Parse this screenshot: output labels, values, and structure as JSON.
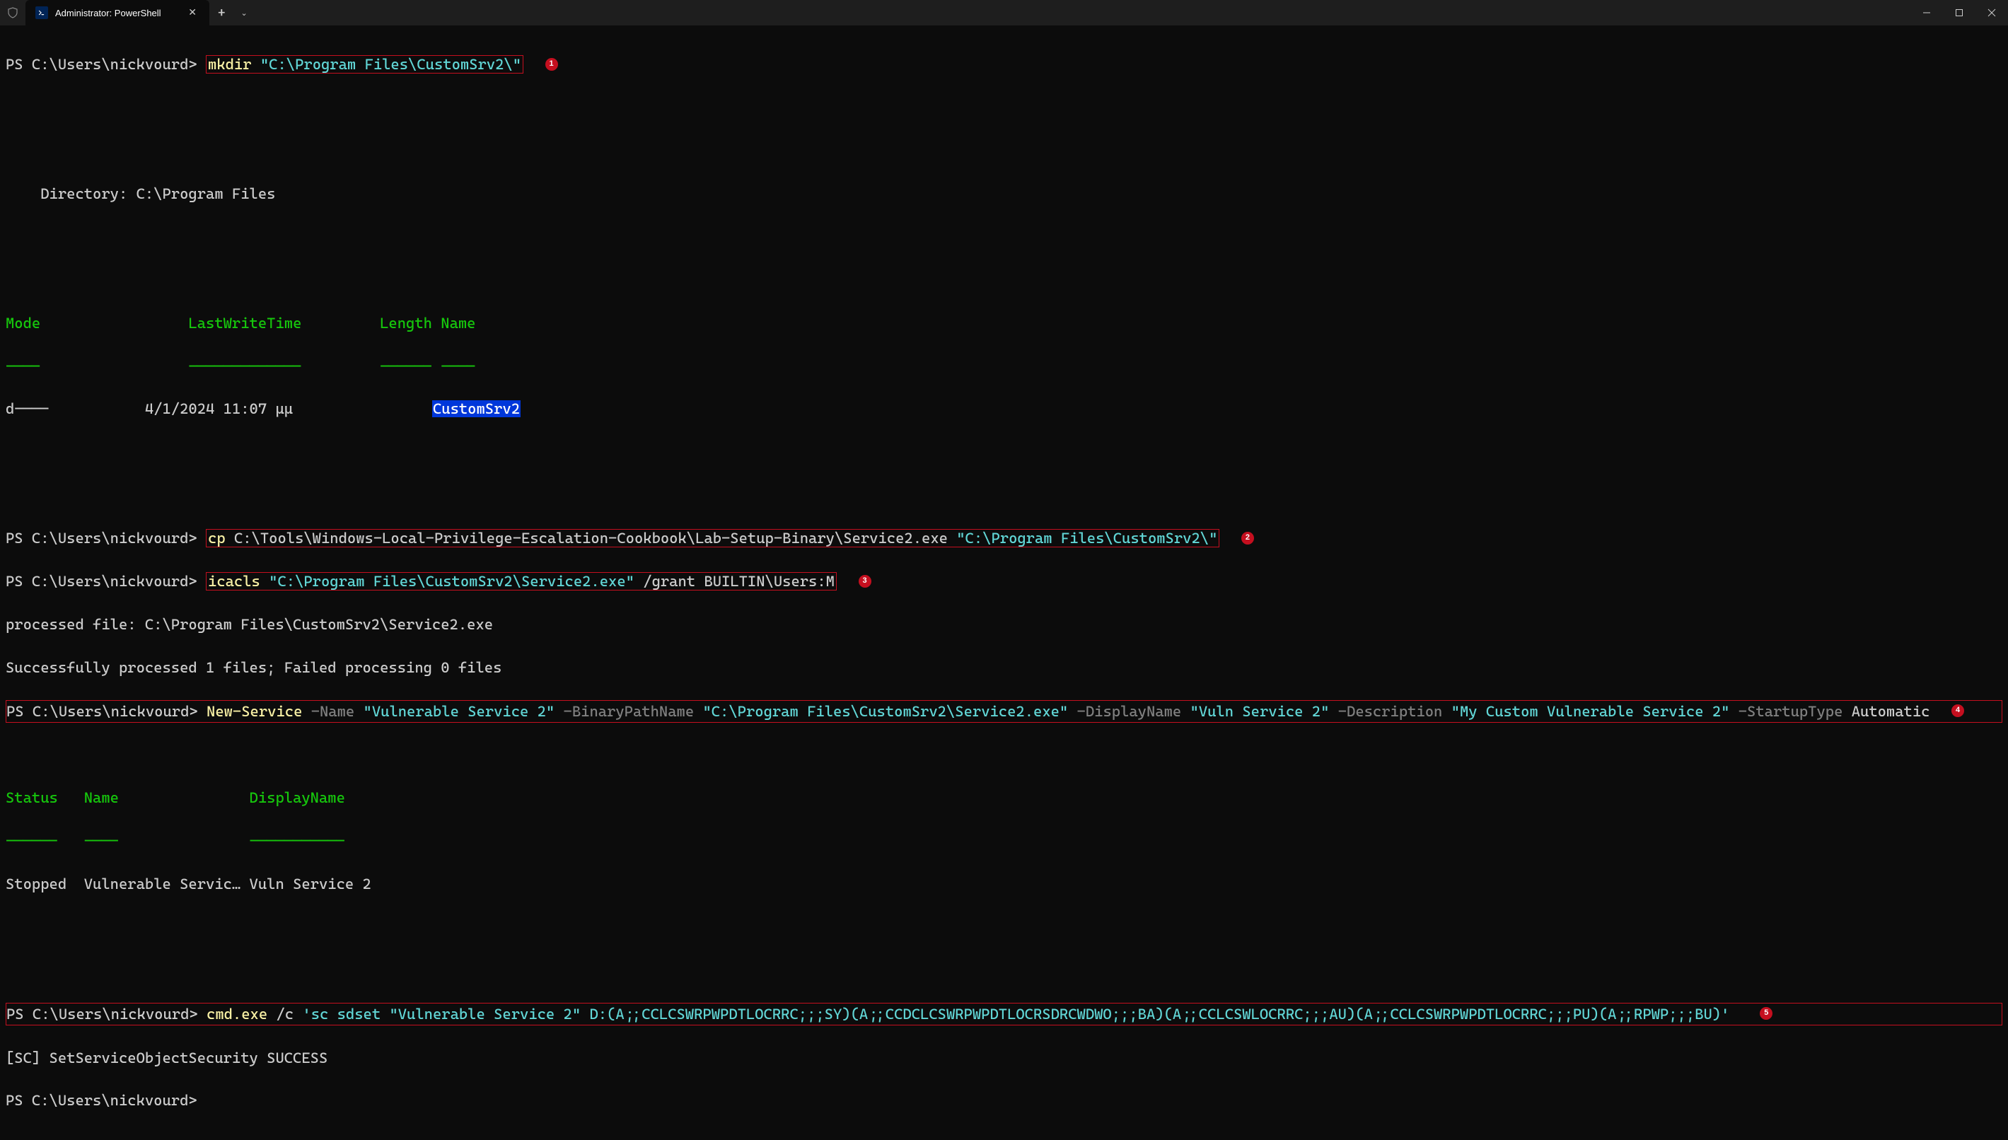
{
  "titlebar": {
    "tab_title": "Administrator: PowerShell",
    "new_tab": "+",
    "dropdown": "⌄",
    "minimize": "—",
    "maximize": "❐",
    "close": "✕"
  },
  "prompts": {
    "p1": "PS C:\\Users\\nickvourd> ",
    "dir_label": "    Directory: C:\\Program Files",
    "header_mode": "Mode",
    "header_lwt": "LastWriteTime",
    "header_length": "Length",
    "header_name": "Name",
    "dashes_mode": "----",
    "dashes_lwt": "-------------",
    "dashes_length": "------",
    "dashes_name": "----",
    "row_mode": "d----",
    "row_date": "4/1/2024 11:07 μμ",
    "row_name": "CustomSrv2",
    "processed": "processed file: C:\\Program Files\\CustomSrv2\\Service2.exe",
    "success": "Successfully processed 1 files; Failed processing 0 files",
    "status_hdr": "Status",
    "name_hdr": "Name",
    "display_hdr": "DisplayName",
    "status_dash": "------",
    "name_dash": "----",
    "display_dash": "-----------",
    "row_status": "Stopped",
    "row_name2": "Vulnerable Servic…",
    "row_disp": "Vuln Service 2",
    "sc_result": "[SC] SetServiceObjectSecurity SUCCESS"
  },
  "commands": {
    "cmd1_kw": "mkdir",
    "cmd1_arg": "\"C:\\Program Files\\CustomSrv2\\\"",
    "cmd2_kw": "cp",
    "cmd2_src": "C:\\Tools\\Windows-Local-Privilege-Escalation-Cookbook\\Lab-Setup-Binary\\Service2.exe",
    "cmd2_dst": "\"C:\\Program Files\\CustomSrv2\\\"",
    "cmd3_kw": "icacls",
    "cmd3_path": "\"C:\\Program Files\\CustomSrv2\\Service2.exe\"",
    "cmd3_grant": "/grant BUILTIN\\Users:M",
    "cmd4_kw": "New-Service",
    "cmd4_p_name": "-Name",
    "cmd4_v_name": "\"Vulnerable Service 2\"",
    "cmd4_p_bin": "-BinaryPathName",
    "cmd4_v_bin": "\"C:\\Program Files\\CustomSrv2\\Service2.exe\"",
    "cmd4_p_disp": "-DisplayName",
    "cmd4_v_disp": "\"Vuln Service 2\"",
    "cmd4_p_desc": "-Description",
    "cmd4_v_desc": "\"My Custom Vulnerable Service 2\"",
    "cmd4_p_start": "-StartupType",
    "cmd4_v_start": "Automatic",
    "cmd5_kw": "cmd.exe",
    "cmd5_c": "/c",
    "cmd5_arg": "'sc sdset \"Vulnerable Service 2\" D:(A;;CCLCSWRPWPDTLOCRRC;;;SY)(A;;CCDCLCSWRPWPDTLOCRSDRCWDWO;;;BA)(A;;CCLCSWLOCRRC;;;AU)(A;;CCLCSWRPWPDTLOCRRC;;;PU)(A;;RPWP;;;BU)'"
  },
  "badges": {
    "b1": "1",
    "b2": "2",
    "b3": "3",
    "b4": "4",
    "b5": "5"
  }
}
